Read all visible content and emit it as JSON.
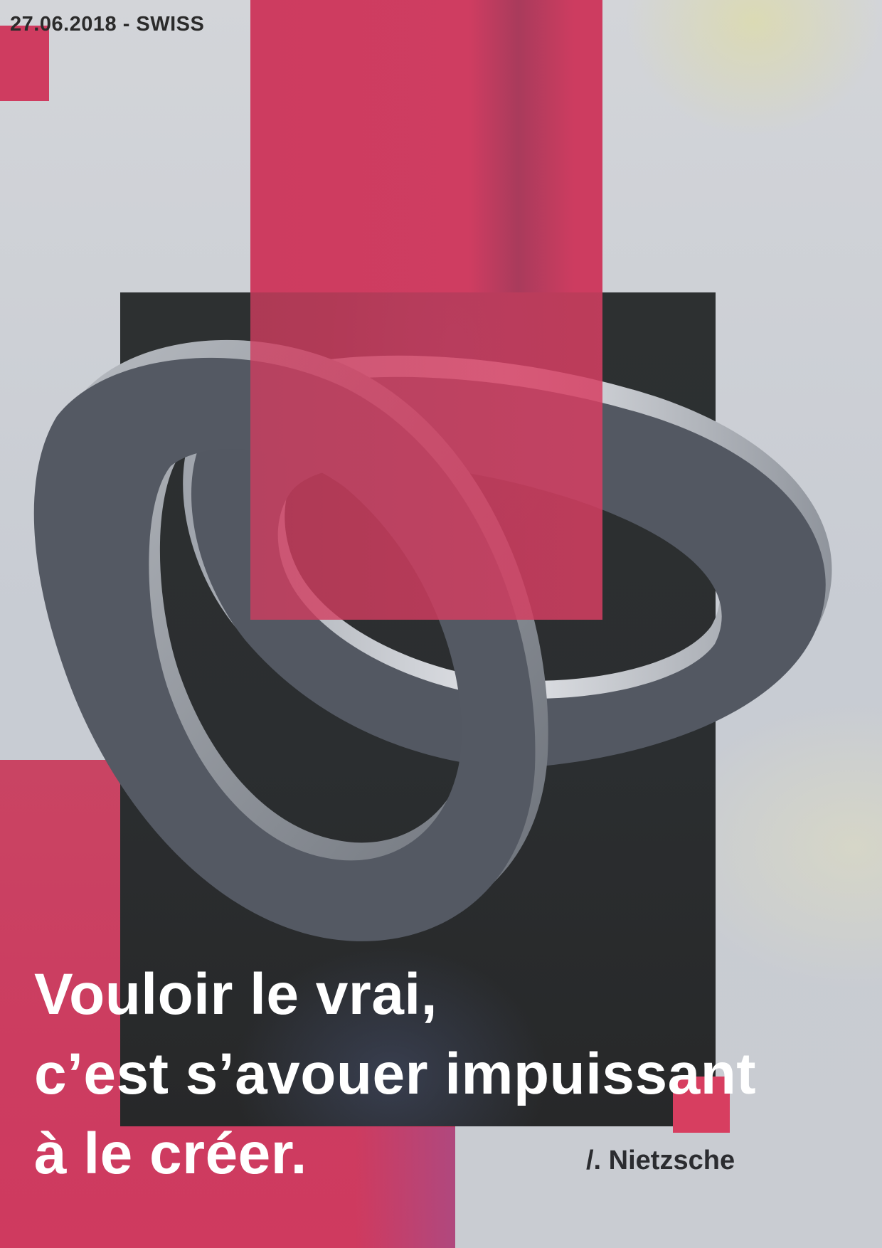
{
  "header": {
    "date_location": "27.06.2018 - SWISS"
  },
  "quote": {
    "line1": "Vouloir le vrai,",
    "line2": "c’est s’avouer impuissant",
    "line3": "à le créer."
  },
  "author": "/. Nietzsche",
  "colors": {
    "accent_red": "#cf3c60",
    "dark_panel": "#2b2e30",
    "background": "#d3d5d9",
    "ring_gray": "#535862"
  }
}
